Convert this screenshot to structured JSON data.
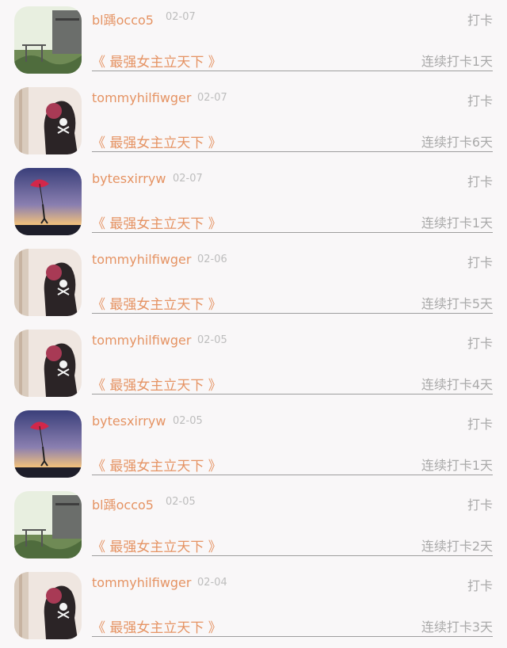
{
  "punch_label": "打卡",
  "items": [
    {
      "user": "bl踽occo5",
      "date": "02-07",
      "book": "《 最强女主立天下 》",
      "streak": "连续打卡1天",
      "avatar": "landscape-avatar-icon"
    },
    {
      "user": "tommyhilfiwger",
      "date": "02-07",
      "book": "《 最强女主立天下 》",
      "streak": "连续打卡6天",
      "avatar": "skull-avatar-icon"
    },
    {
      "user": "bytesxirryw",
      "date": "02-07",
      "book": "《 最强女主立天下 》",
      "streak": "连续打卡1天",
      "avatar": "umbrella-avatar-icon"
    },
    {
      "user": "tommyhilfiwger",
      "date": "02-06",
      "book": "《 最强女主立天下 》",
      "streak": "连续打卡5天",
      "avatar": "skull-avatar-icon"
    },
    {
      "user": "tommyhilfiwger",
      "date": "02-05",
      "book": "《 最强女主立天下 》",
      "streak": "连续打卡4天",
      "avatar": "skull-avatar-icon"
    },
    {
      "user": "bytesxirryw",
      "date": "02-05",
      "book": "《 最强女主立天下 》",
      "streak": "连续打卡1天",
      "avatar": "umbrella-avatar-icon"
    },
    {
      "user": "bl踽occo5",
      "date": "02-05",
      "book": "《 最强女主立天下 》",
      "streak": "连续打卡2天",
      "avatar": "landscape-avatar-icon"
    },
    {
      "user": "tommyhilfiwger",
      "date": "02-04",
      "book": "《 最强女主立天下 》",
      "streak": "连续打卡3天",
      "avatar": "skull-avatar-icon"
    }
  ]
}
